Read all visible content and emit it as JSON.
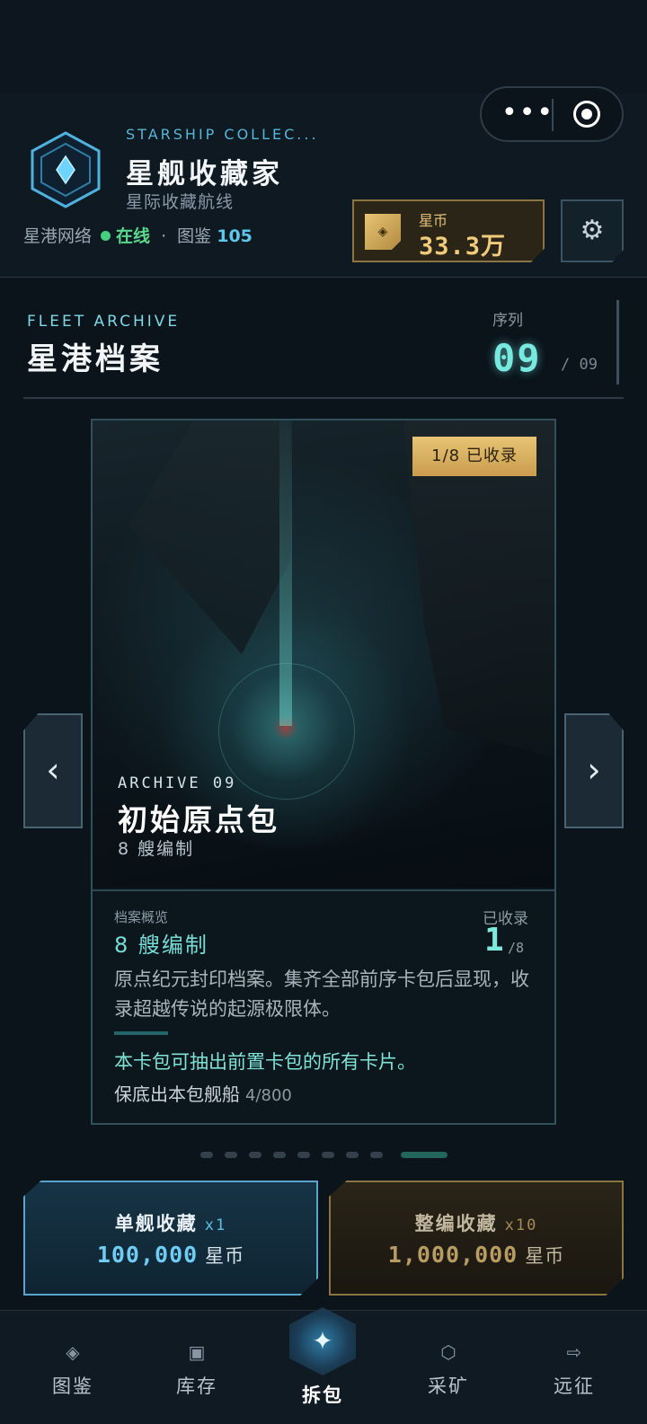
{
  "capsule": {
    "more_label": "•••"
  },
  "header": {
    "subtitle_en": "STARSHIP COLLEC...",
    "title": "星舰收藏家",
    "subtitle": "星际收藏航线",
    "network_label": "星港网络",
    "status": "在线",
    "separator": "·",
    "codex_label": "图鉴",
    "codex_count": "105",
    "coin_label": "星币",
    "coin_value": "33.3万"
  },
  "archive": {
    "label_en": "FLEET ARCHIVE",
    "title": "星港档案",
    "seq_label": "序列",
    "seq_current": "09",
    "seq_total": "/ 09"
  },
  "card": {
    "badge": "1/8 已收录",
    "label_en": "ARCHIVE 09",
    "title": "初始原点包",
    "subtitle": "8 艘编制",
    "overview_label": "档案概览",
    "overview_value": "8 艘编制",
    "collected_label": "已收录",
    "collected_count": "1",
    "collected_total": "/8",
    "description": "原点纪元封印档案。集齐全部前序卡包后显现，收录超越传说的起源极限体。",
    "note": "本卡包可抽出前置卡包的所有卡片。",
    "guarantee_label": "保底出本包舰船",
    "guarantee_count": "4/800"
  },
  "pagination": {
    "total": 9,
    "active_index": 8
  },
  "actions": {
    "single": {
      "label": "单舰收藏",
      "mult": "x1",
      "price": "100,000",
      "unit": "星币"
    },
    "fleet": {
      "label": "整编收藏",
      "mult": "x10",
      "price": "1,000,000",
      "unit": "星币"
    }
  },
  "tabs": [
    {
      "label": "图鉴",
      "icon": "codex-icon"
    },
    {
      "label": "库存",
      "icon": "inventory-icon"
    },
    {
      "label": "拆包",
      "icon": "open-pack-icon"
    },
    {
      "label": "采矿",
      "icon": "mining-icon"
    },
    {
      "label": "远征",
      "icon": "expedition-icon"
    }
  ],
  "colors": {
    "accent": "#77e9df",
    "gold": "#f0cb7c",
    "blue": "#6fcdf3",
    "online": "#45d07d"
  }
}
